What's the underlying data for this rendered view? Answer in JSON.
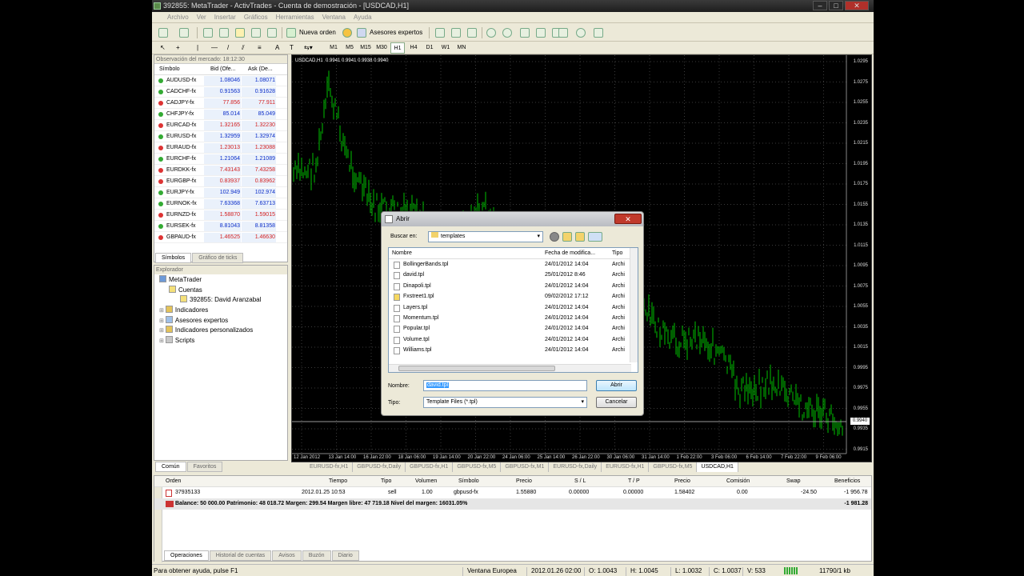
{
  "window": {
    "title": "392855: MetaTrader - ActivTrades - Cuenta de demostración - [USDCAD,H1]"
  },
  "menu": [
    "Archivo",
    "Ver",
    "Insertar",
    "Gráficos",
    "Herramientas",
    "Ventana",
    "Ayuda"
  ],
  "toolbar": {
    "new_order": "Nueva orden",
    "expert_advisors": "Asesores expertos"
  },
  "timeframes": [
    "M1",
    "M5",
    "M15",
    "M30",
    "H1",
    "H4",
    "D1",
    "W1",
    "MN"
  ],
  "selected_timeframe": "H1",
  "market_watch": {
    "header": "Observación del mercado: 18:12:30",
    "col_symbol": "Símbolo",
    "col_bid": "Bid (Ofe...",
    "col_ask": "Ask (De...",
    "rows": [
      {
        "symbol": "AUDUSD-fx",
        "bid": "1.08046",
        "ask": "1.08071",
        "dir": "up"
      },
      {
        "symbol": "CADCHF-fx",
        "bid": "0.91563",
        "ask": "0.91628",
        "dir": "up"
      },
      {
        "symbol": "CADJPY-fx",
        "bid": "77.856",
        "ask": "77.911",
        "dir": "down"
      },
      {
        "symbol": "CHFJPY-fx",
        "bid": "85.014",
        "ask": "85.049",
        "dir": "up"
      },
      {
        "symbol": "EURCAD-fx",
        "bid": "1.32165",
        "ask": "1.32230",
        "dir": "down"
      },
      {
        "symbol": "EURUSD-fx",
        "bid": "1.32959",
        "ask": "1.32974",
        "dir": "up"
      },
      {
        "symbol": "EURAUD-fx",
        "bid": "1.23013",
        "ask": "1.23088",
        "dir": "down"
      },
      {
        "symbol": "EURCHF-fx",
        "bid": "1.21064",
        "ask": "1.21089",
        "dir": "up"
      },
      {
        "symbol": "EURDKK-fx",
        "bid": "7.43143",
        "ask": "7.43258",
        "dir": "down"
      },
      {
        "symbol": "EURGBP-fx",
        "bid": "0.83937",
        "ask": "0.83962",
        "dir": "down"
      },
      {
        "symbol": "EURJPY-fx",
        "bid": "102.949",
        "ask": "102.974",
        "dir": "up"
      },
      {
        "symbol": "EURNOK-fx",
        "bid": "7.63368",
        "ask": "7.63713",
        "dir": "up"
      },
      {
        "symbol": "EURNZD-fx",
        "bid": "1.58870",
        "ask": "1.59015",
        "dir": "down"
      },
      {
        "symbol": "EURSEK-fx",
        "bid": "8.81043",
        "ask": "8.81358",
        "dir": "up"
      },
      {
        "symbol": "GBPAUD-fx",
        "bid": "1.46525",
        "ask": "1.46630",
        "dir": "down"
      }
    ],
    "tabs": [
      "Símbolos",
      "Gráfico de ticks"
    ]
  },
  "explorer": {
    "header": "Explorador",
    "items": [
      "MetaTrader",
      "Cuentas",
      "392855: David Aranzabal",
      "Indicadores",
      "Asesores expertos",
      "Indicadores personalizados",
      "Scripts"
    ],
    "tabs": [
      "Común",
      "Favoritos"
    ]
  },
  "chart": {
    "title": "USDCAD,H1",
    "ohlc": "0.9941 0.9941 0.9938 0.9940",
    "current_price": "0.9940",
    "y_ticks": [
      "1.0295",
      "1.0275",
      "1.0255",
      "1.0235",
      "1.0215",
      "1.0195",
      "1.0175",
      "1.0155",
      "1.0135",
      "1.0115",
      "1.0095",
      "1.0075",
      "1.0055",
      "1.0035",
      "1.0015",
      "0.9995",
      "0.9975",
      "0.9955",
      "0.9935",
      "0.9915"
    ],
    "x_ticks": [
      "12 Jan 2012",
      "13 Jan 14:00",
      "16 Jan 22:00",
      "18 Jan 06:00",
      "19 Jan 14:00",
      "20 Jan 22:00",
      "24 Jan 06:00",
      "25 Jan 14:00",
      "26 Jan 22:00",
      "30 Jan 06:00",
      "31 Jan 14:00",
      "1 Feb 22:00",
      "3 Feb 06:00",
      "6 Feb 14:00",
      "7 Feb 22:00",
      "9 Feb 06:00"
    ],
    "colors": {
      "candle": "#00c000",
      "grid": "#3a3a3a",
      "background": "#000000"
    }
  },
  "chart_tabs": [
    "EURUSD-fx,H1",
    "GBPUSD-fx,Daily",
    "GBPUSD-fx,H1",
    "GBPUSD-fx,M5",
    "GBPUSD-fx,M1",
    "EURUSD-fx,Daily",
    "EURUSD-fx,H1",
    "GBPUSD-fx,M5",
    "USDCAD,H1"
  ],
  "active_chart_tab": "USDCAD,H1",
  "terminal": {
    "columns": [
      "Orden",
      "Tiempo",
      "Tipo",
      "Volumen",
      "Símbolo",
      "Precio",
      "S / L",
      "T / P",
      "Precio",
      "Comisión",
      "Swap",
      "Beneficios"
    ],
    "order": {
      "order": "37935133",
      "time": "2012.01.25 10:53",
      "type": "sell",
      "volume": "1.00",
      "symbol": "gbpusd-fx",
      "price": "1.55880",
      "sl": "0.00000",
      "tp": "0.00000",
      "price2": "1.58402",
      "commission": "0.00",
      "swap": "-24.50",
      "profit": "-1 956.78"
    },
    "balance_text": "Balance: 50 000.00  Patrimonio: 48 018.72  Margen: 299.54  Margen libre: 47 719.18  Nivel del margen: 16031.05%",
    "balance_profit": "-1 981.28",
    "tabs": [
      "Operaciones",
      "Historial de cuentas",
      "Avisos",
      "Buzón",
      "Diario"
    ],
    "side_label": "Terminal"
  },
  "status": {
    "help": "Para obtener ayuda, pulse F1",
    "profile": "Ventana Europea",
    "datetime": "2012.01.26 02:00",
    "open": "O: 1.0043",
    "high": "H: 1.0045",
    "low": "L: 1.0032",
    "close": "C: 1.0037",
    "volume": "V: 533",
    "traffic": "11790/1 kb"
  },
  "dialog": {
    "title": "Abrir",
    "look_in_label": "Buscar en:",
    "look_in_value": "templates",
    "col_name": "Nombre",
    "col_date": "Fecha de modifica...",
    "col_type": "Tipo",
    "files": [
      {
        "name": "BollingerBands.tpl",
        "date": "24/01/2012 14:04",
        "type": "Archi"
      },
      {
        "name": "david.tpl",
        "date": "25/01/2012 8:46",
        "type": "Archi"
      },
      {
        "name": "Dinapoli.tpl",
        "date": "24/01/2012 14:04",
        "type": "Archi"
      },
      {
        "name": "Fxstreet1.tpl",
        "date": "09/02/2012 17:12",
        "type": "Archi"
      },
      {
        "name": "Layers.tpl",
        "date": "24/01/2012 14:04",
        "type": "Archi"
      },
      {
        "name": "Momentum.tpl",
        "date": "24/01/2012 14:04",
        "type": "Archi"
      },
      {
        "name": "Popular.tpl",
        "date": "24/01/2012 14:04",
        "type": "Archi"
      },
      {
        "name": "Volume.tpl",
        "date": "24/01/2012 14:04",
        "type": "Archi"
      },
      {
        "name": "Williams.tpl",
        "date": "24/01/2012 14:04",
        "type": "Archi"
      }
    ],
    "name_label": "Nombre:",
    "name_value": "david.tpl",
    "type_label": "Tipo:",
    "type_value": "Template Files (*.tpl)",
    "open_button": "Abrir",
    "cancel_button": "Cancelar"
  }
}
